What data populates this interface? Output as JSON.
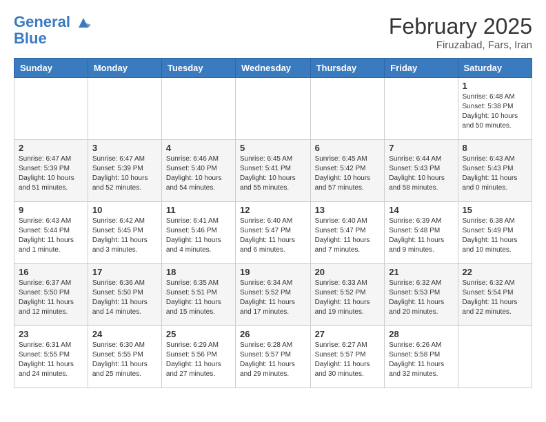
{
  "header": {
    "logo_line1": "General",
    "logo_line2": "Blue",
    "title": "February 2025",
    "subtitle": "Firuzabad, Fars, Iran"
  },
  "weekdays": [
    "Sunday",
    "Monday",
    "Tuesday",
    "Wednesday",
    "Thursday",
    "Friday",
    "Saturday"
  ],
  "weeks": [
    [
      {
        "day": "",
        "info": ""
      },
      {
        "day": "",
        "info": ""
      },
      {
        "day": "",
        "info": ""
      },
      {
        "day": "",
        "info": ""
      },
      {
        "day": "",
        "info": ""
      },
      {
        "day": "",
        "info": ""
      },
      {
        "day": "1",
        "info": "Sunrise: 6:48 AM\nSunset: 5:38 PM\nDaylight: 10 hours\nand 50 minutes."
      }
    ],
    [
      {
        "day": "2",
        "info": "Sunrise: 6:47 AM\nSunset: 5:39 PM\nDaylight: 10 hours\nand 51 minutes."
      },
      {
        "day": "3",
        "info": "Sunrise: 6:47 AM\nSunset: 5:39 PM\nDaylight: 10 hours\nand 52 minutes."
      },
      {
        "day": "4",
        "info": "Sunrise: 6:46 AM\nSunset: 5:40 PM\nDaylight: 10 hours\nand 54 minutes."
      },
      {
        "day": "5",
        "info": "Sunrise: 6:45 AM\nSunset: 5:41 PM\nDaylight: 10 hours\nand 55 minutes."
      },
      {
        "day": "6",
        "info": "Sunrise: 6:45 AM\nSunset: 5:42 PM\nDaylight: 10 hours\nand 57 minutes."
      },
      {
        "day": "7",
        "info": "Sunrise: 6:44 AM\nSunset: 5:43 PM\nDaylight: 10 hours\nand 58 minutes."
      },
      {
        "day": "8",
        "info": "Sunrise: 6:43 AM\nSunset: 5:43 PM\nDaylight: 11 hours\nand 0 minutes."
      }
    ],
    [
      {
        "day": "9",
        "info": "Sunrise: 6:43 AM\nSunset: 5:44 PM\nDaylight: 11 hours\nand 1 minute."
      },
      {
        "day": "10",
        "info": "Sunrise: 6:42 AM\nSunset: 5:45 PM\nDaylight: 11 hours\nand 3 minutes."
      },
      {
        "day": "11",
        "info": "Sunrise: 6:41 AM\nSunset: 5:46 PM\nDaylight: 11 hours\nand 4 minutes."
      },
      {
        "day": "12",
        "info": "Sunrise: 6:40 AM\nSunset: 5:47 PM\nDaylight: 11 hours\nand 6 minutes."
      },
      {
        "day": "13",
        "info": "Sunrise: 6:40 AM\nSunset: 5:47 PM\nDaylight: 11 hours\nand 7 minutes."
      },
      {
        "day": "14",
        "info": "Sunrise: 6:39 AM\nSunset: 5:48 PM\nDaylight: 11 hours\nand 9 minutes."
      },
      {
        "day": "15",
        "info": "Sunrise: 6:38 AM\nSunset: 5:49 PM\nDaylight: 11 hours\nand 10 minutes."
      }
    ],
    [
      {
        "day": "16",
        "info": "Sunrise: 6:37 AM\nSunset: 5:50 PM\nDaylight: 11 hours\nand 12 minutes."
      },
      {
        "day": "17",
        "info": "Sunrise: 6:36 AM\nSunset: 5:50 PM\nDaylight: 11 hours\nand 14 minutes."
      },
      {
        "day": "18",
        "info": "Sunrise: 6:35 AM\nSunset: 5:51 PM\nDaylight: 11 hours\nand 15 minutes."
      },
      {
        "day": "19",
        "info": "Sunrise: 6:34 AM\nSunset: 5:52 PM\nDaylight: 11 hours\nand 17 minutes."
      },
      {
        "day": "20",
        "info": "Sunrise: 6:33 AM\nSunset: 5:52 PM\nDaylight: 11 hours\nand 19 minutes."
      },
      {
        "day": "21",
        "info": "Sunrise: 6:32 AM\nSunset: 5:53 PM\nDaylight: 11 hours\nand 20 minutes."
      },
      {
        "day": "22",
        "info": "Sunrise: 6:32 AM\nSunset: 5:54 PM\nDaylight: 11 hours\nand 22 minutes."
      }
    ],
    [
      {
        "day": "23",
        "info": "Sunrise: 6:31 AM\nSunset: 5:55 PM\nDaylight: 11 hours\nand 24 minutes."
      },
      {
        "day": "24",
        "info": "Sunrise: 6:30 AM\nSunset: 5:55 PM\nDaylight: 11 hours\nand 25 minutes."
      },
      {
        "day": "25",
        "info": "Sunrise: 6:29 AM\nSunset: 5:56 PM\nDaylight: 11 hours\nand 27 minutes."
      },
      {
        "day": "26",
        "info": "Sunrise: 6:28 AM\nSunset: 5:57 PM\nDaylight: 11 hours\nand 29 minutes."
      },
      {
        "day": "27",
        "info": "Sunrise: 6:27 AM\nSunset: 5:57 PM\nDaylight: 11 hours\nand 30 minutes."
      },
      {
        "day": "28",
        "info": "Sunrise: 6:26 AM\nSunset: 5:58 PM\nDaylight: 11 hours\nand 32 minutes."
      },
      {
        "day": "",
        "info": ""
      }
    ]
  ]
}
